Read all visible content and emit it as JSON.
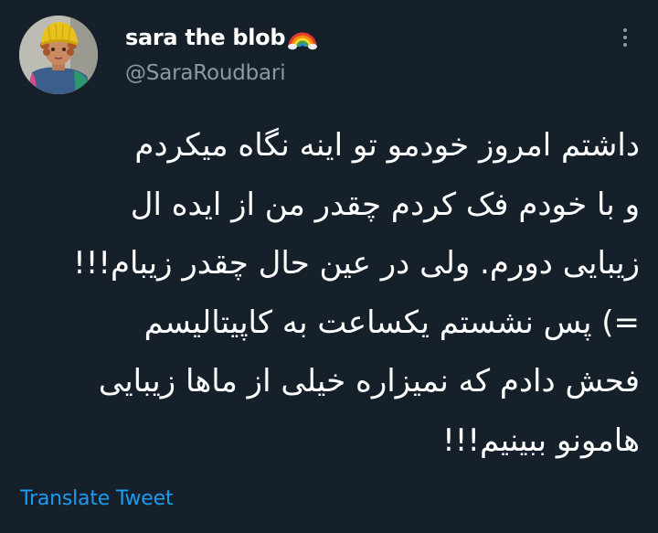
{
  "author": {
    "display_name": "sara the blob",
    "handle": "@SaraRoudbari",
    "name_emoji": "rainbow-icon",
    "avatar": "avatar"
  },
  "tweet": {
    "lines": [
      "داشتم امروز خودمو تو اینه نگاه میکردم",
      "و با خودم فک کردم چقدر من از ایده ال",
      "زیبایی دورم. ولی در عین حال چقدر زیبام!!!",
      "=) پس نشستم یکساعت به کاپیتالیسم",
      "فحش دادم که نمیزاره خیلی از ماها زیبایی",
      "هامونو ببینیم!!!"
    ]
  },
  "actions": {
    "translate_label": "Translate Tweet",
    "more_icon": "more-icon"
  },
  "colors": {
    "background": "#15202b",
    "secondary_text": "#8b98a5",
    "link": "#1d9bf0"
  }
}
